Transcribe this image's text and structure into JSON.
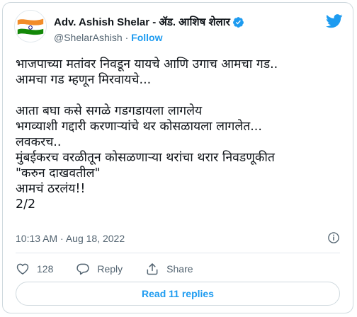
{
  "author": {
    "display_name": "Adv. Ashish Shelar - ॲड. आशिष शेलार",
    "handle": "@ShelarAshish",
    "separator": "·",
    "follow_label": "Follow"
  },
  "tweet": {
    "text": "भाजपाच्या मतांवर निवडून यायचे आणि उगाच आमचा गड..\nआमचा गड म्हणून मिरवायचे...\n\nआता बघा कसे सगळे गडगडायला लागलेय\nभगव्याशी गद्दारी करणाऱ्यांचे थर कोसळायला लागलेत...\n लवकरच..\nमुंबईकरच वरळीतून कोसळणाऱ्या थरांचा थरार निवडणूकीत\n\"करुन दाखवतील\"\nआमचं ठरलंय!!\n2/2",
    "timestamp": "10:13 AM · Aug 18, 2022"
  },
  "actions": {
    "like_count": "128",
    "reply_label": "Reply",
    "share_label": "Share"
  },
  "read_replies_label": "Read 11 replies",
  "colors": {
    "accent": "#1d9bf0",
    "secondary_text": "#536471",
    "border": "#cfd9de"
  },
  "icons": [
    "tricolor-flag-avatar",
    "verified-badge-icon",
    "twitter-bird-icon",
    "info-icon",
    "heart-icon",
    "reply-icon",
    "share-icon"
  ]
}
